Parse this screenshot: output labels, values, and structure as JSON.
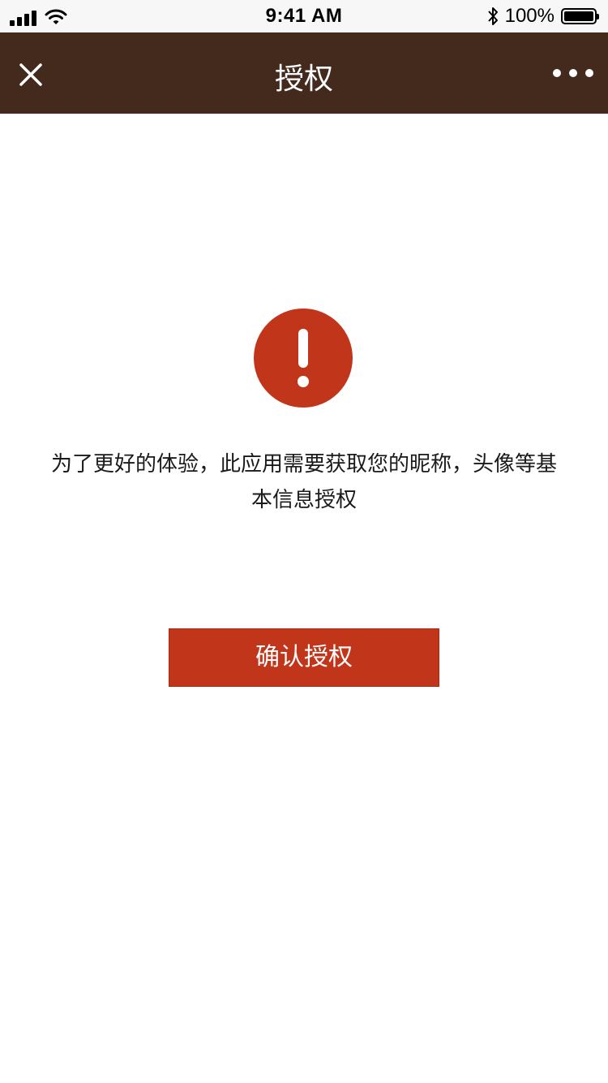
{
  "status_bar": {
    "time": "9:41 AM",
    "battery_text": "100%",
    "signal_icon": "cellular-signal-icon",
    "wifi_icon": "wifi-icon",
    "bluetooth_icon": "bluetooth-icon",
    "battery_icon": "battery-icon",
    "battery_level": 1.0
  },
  "nav_bar": {
    "title": "授权",
    "close_icon": "close-icon",
    "more_icon": "more-icon",
    "background_color": "#442a1c"
  },
  "content": {
    "alert_icon": "exclamation-icon",
    "message": "为了更好的体验，此应用需要获取您的昵称，头像等基本信息授权",
    "accent_color": "#c1361b"
  },
  "actions": {
    "confirm_label": "确认授权"
  }
}
